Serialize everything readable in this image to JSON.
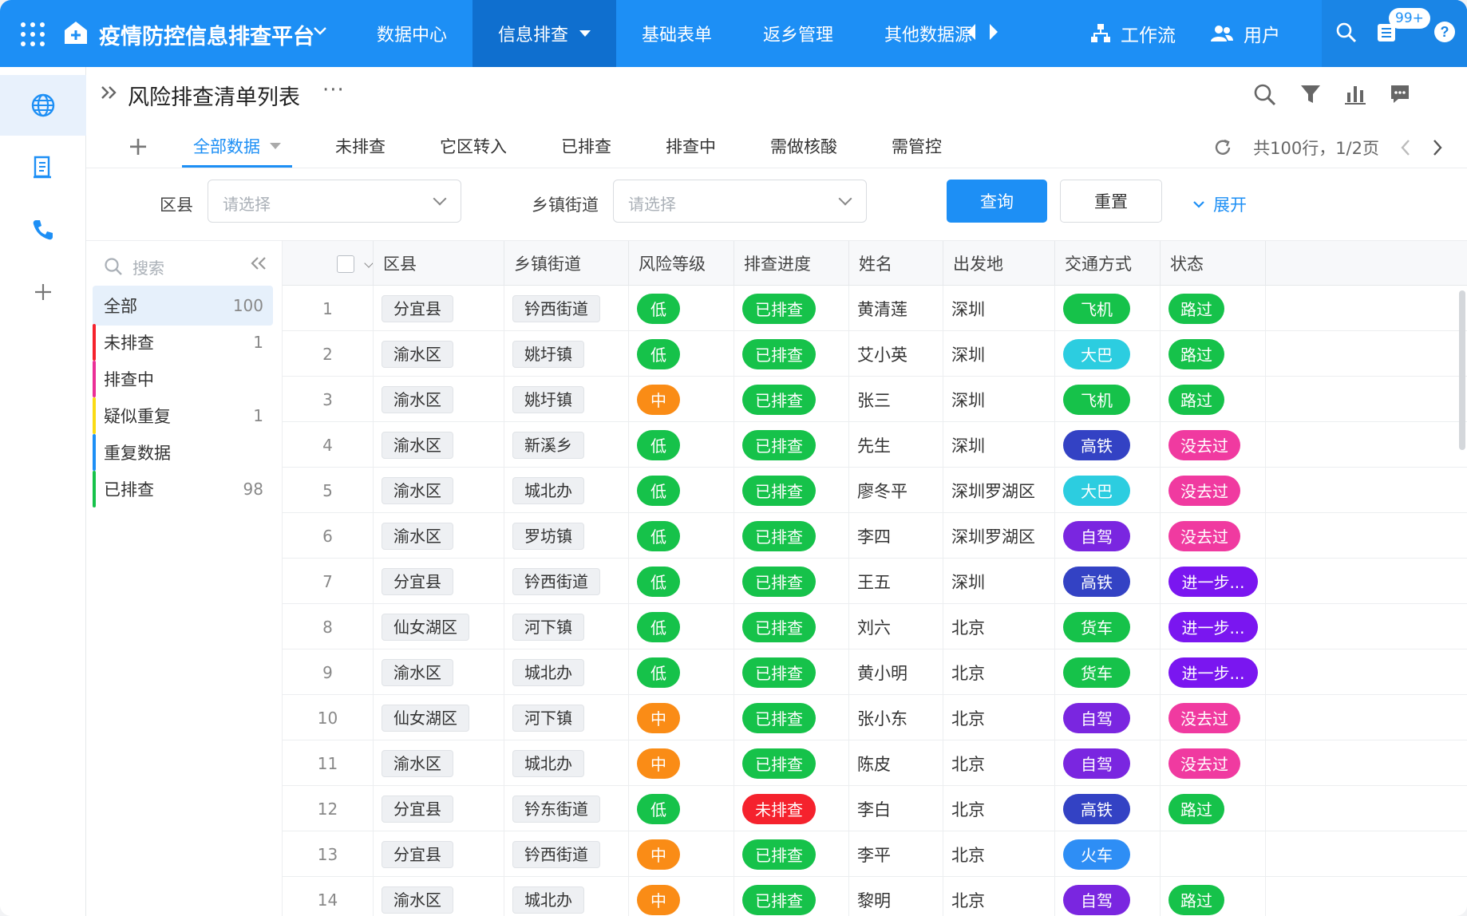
{
  "app": {
    "title": "疫情防控信息排查平台",
    "nav": [
      {
        "label": "数据中心",
        "active": false
      },
      {
        "label": "信息排查",
        "active": true
      },
      {
        "label": "基础表单",
        "active": false
      },
      {
        "label": "返乡管理",
        "active": false
      }
    ],
    "nav_overflow_label": "其他数据源",
    "workflow_label": "工作流",
    "users_label": "用户",
    "notifications_badge": "99+"
  },
  "page": {
    "title": "风险排查清单列表",
    "tabs": [
      {
        "label": "全部数据",
        "active": true
      },
      {
        "label": "未排查",
        "active": false
      },
      {
        "label": "它区转入",
        "active": false
      },
      {
        "label": "已排查",
        "active": false
      },
      {
        "label": "排查中",
        "active": false
      },
      {
        "label": "需做核酸",
        "active": false
      },
      {
        "label": "需管控",
        "active": false
      }
    ],
    "pager_text": "共100行，1/2页"
  },
  "filter": {
    "district_label": "区县",
    "district_placeholder": "请选择",
    "street_label": "乡镇街道",
    "street_placeholder": "请选择",
    "query_label": "查询",
    "reset_label": "重置",
    "expand_label": "展开"
  },
  "groups": {
    "search_placeholder": "搜索",
    "items": [
      {
        "label": "全部",
        "count": "100",
        "color": "",
        "active": true
      },
      {
        "label": "未排查",
        "count": "1",
        "color": "#f5222d",
        "active": false
      },
      {
        "label": "排查中",
        "count": "",
        "color": "#eb2f96",
        "active": false
      },
      {
        "label": "疑似重复",
        "count": "1",
        "color": "#fadb14",
        "active": false
      },
      {
        "label": "重复数据",
        "count": "",
        "color": "#1d8ff5",
        "active": false
      },
      {
        "label": "已排查",
        "count": "98",
        "color": "#16c24a",
        "active": false
      }
    ]
  },
  "table": {
    "columns": [
      "区县",
      "乡镇街道",
      "风险等级",
      "排查进度",
      "姓名",
      "出发地",
      "交通方式",
      "状态"
    ],
    "rows": [
      {
        "n": "1",
        "district": "分宜县",
        "street": "钤西街道",
        "risk": "低",
        "progress": "已排查",
        "name": "黄清莲",
        "origin": "深圳",
        "transport": "飞机",
        "status": "路过"
      },
      {
        "n": "2",
        "district": "渝水区",
        "street": "姚圩镇",
        "risk": "低",
        "progress": "已排查",
        "name": "艾小英",
        "origin": "深圳",
        "transport": "大巴",
        "status": "路过"
      },
      {
        "n": "3",
        "district": "渝水区",
        "street": "姚圩镇",
        "risk": "中",
        "progress": "已排查",
        "name": "张三",
        "origin": "深圳",
        "transport": "飞机",
        "status": "路过"
      },
      {
        "n": "4",
        "district": "渝水区",
        "street": "新溪乡",
        "risk": "低",
        "progress": "已排查",
        "name": "先生",
        "origin": "深圳",
        "transport": "高铁",
        "status": "没去过"
      },
      {
        "n": "5",
        "district": "渝水区",
        "street": "城北办",
        "risk": "低",
        "progress": "已排查",
        "name": "廖冬平",
        "origin": "深圳罗湖区",
        "transport": "大巴",
        "status": "没去过"
      },
      {
        "n": "6",
        "district": "渝水区",
        "street": "罗坊镇",
        "risk": "低",
        "progress": "已排查",
        "name": "李四",
        "origin": "深圳罗湖区",
        "transport": "自驾",
        "status": "没去过"
      },
      {
        "n": "7",
        "district": "分宜县",
        "street": "钤西街道",
        "risk": "低",
        "progress": "已排查",
        "name": "王五",
        "origin": "深圳",
        "transport": "高铁",
        "status": "进一步..."
      },
      {
        "n": "8",
        "district": "仙女湖区",
        "street": "河下镇",
        "risk": "低",
        "progress": "已排查",
        "name": "刘六",
        "origin": "北京",
        "transport": "货车",
        "status": "进一步..."
      },
      {
        "n": "9",
        "district": "渝水区",
        "street": "城北办",
        "risk": "低",
        "progress": "已排查",
        "name": "黄小明",
        "origin": "北京",
        "transport": "货车",
        "status": "进一步..."
      },
      {
        "n": "10",
        "district": "仙女湖区",
        "street": "河下镇",
        "risk": "中",
        "progress": "已排查",
        "name": "张小东",
        "origin": "北京",
        "transport": "自驾",
        "status": "没去过"
      },
      {
        "n": "11",
        "district": "渝水区",
        "street": "城北办",
        "risk": "中",
        "progress": "已排查",
        "name": "陈皮",
        "origin": "北京",
        "transport": "自驾",
        "status": "没去过"
      },
      {
        "n": "12",
        "district": "分宜县",
        "street": "钤东街道",
        "risk": "低",
        "progress": "未排查",
        "name": "李白",
        "origin": "北京",
        "transport": "高铁",
        "status": "路过"
      },
      {
        "n": "13",
        "district": "分宜县",
        "street": "钤西街道",
        "risk": "中",
        "progress": "已排查",
        "name": "李平",
        "origin": "北京",
        "transport": "火车",
        "status": ""
      },
      {
        "n": "14",
        "district": "渝水区",
        "street": "城北办",
        "risk": "中",
        "progress": "已排查",
        "name": "黎明",
        "origin": "北京",
        "transport": "自驾",
        "status": "路过"
      }
    ]
  },
  "colors": {
    "primary": "#1d8ff5",
    "risk": {
      "低": "#16c24a",
      "中": "#fa8c16"
    },
    "progress": {
      "已排查": "#16c24a",
      "未排查": "#f5222d"
    },
    "transport": {
      "飞机": "#16c24a",
      "大巴": "#2ccde0",
      "高铁": "#3342c4",
      "自驾": "#7a26e0",
      "货车": "#16c24a",
      "火车": "#2e8ef5"
    },
    "status": {
      "路过": "#16c24a",
      "没去过": "#f03aa0",
      "进一步...": "#7a16f0"
    }
  }
}
